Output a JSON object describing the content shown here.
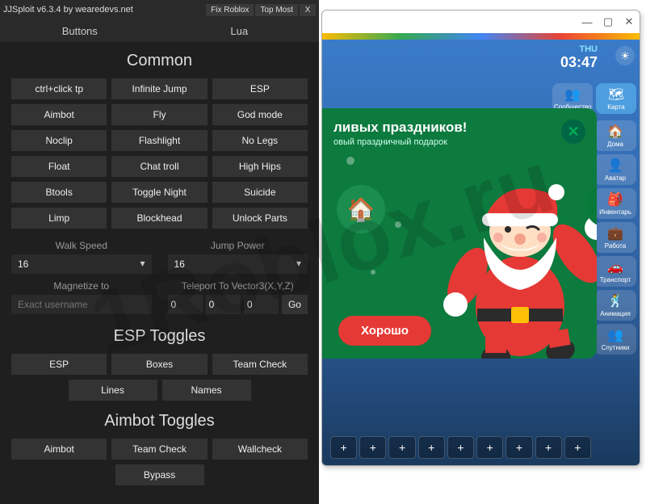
{
  "jjs": {
    "title": "JJSploit v6.3.4 by wearedevs.net",
    "fix": "Fix Roblox",
    "topmost": "Top Most",
    "close": "X",
    "tabs": {
      "buttons": "Buttons",
      "lua": "Lua"
    },
    "common": {
      "heading": "Common",
      "buttons": [
        "ctrl+click tp",
        "Infinite Jump",
        "ESP",
        "Aimbot",
        "Fly",
        "God mode",
        "Noclip",
        "Flashlight",
        "No Legs",
        "Float",
        "Chat troll",
        "High Hips",
        "Btools",
        "Toggle Night",
        "Suicide",
        "Limp",
        "Blockhead",
        "Unlock Parts"
      ]
    },
    "walk": {
      "label": "Walk Speed",
      "value": "16"
    },
    "jump": {
      "label": "Jump Power",
      "value": "16"
    },
    "magnetize": {
      "label": "Magnetize to",
      "placeholder": "Exact username"
    },
    "teleport": {
      "label": "Teleport To Vector3(X,Y,Z)",
      "x": "0",
      "y": "0",
      "z": "0",
      "go": "Go"
    },
    "esp": {
      "heading": "ESP Toggles",
      "row1": [
        "ESP",
        "Boxes",
        "Team Check"
      ],
      "row2": [
        "Lines",
        "Names"
      ]
    },
    "aimbot": {
      "heading": "Aimbot Toggles",
      "row1": [
        "Aimbot",
        "Team Check",
        "Wallcheck"
      ],
      "row2": [
        "Bypass"
      ]
    }
  },
  "rbx": {
    "hud": {
      "day": "THU",
      "time": "03:47"
    },
    "sidebar_top": {
      "community": "Сообщество",
      "map": "Карта"
    },
    "sidebar": [
      {
        "icon": "🏠",
        "label": "Дома"
      },
      {
        "icon": "👤",
        "label": "Аватар"
      },
      {
        "icon": "🎒",
        "label": "Инвентарь"
      },
      {
        "icon": "💼",
        "label": "Работа"
      },
      {
        "icon": "🚗",
        "label": "Транспорт"
      },
      {
        "icon": "🕺",
        "label": "Анимация"
      },
      {
        "icon": "👥",
        "label": "Спутники"
      }
    ],
    "modal": {
      "title": "ливых праздников!",
      "sub": "овый праздничный подарок",
      "ok": "Хорошо",
      "close": "✕"
    },
    "slot": "+"
  },
  "watermark": "1Roblox.ru"
}
